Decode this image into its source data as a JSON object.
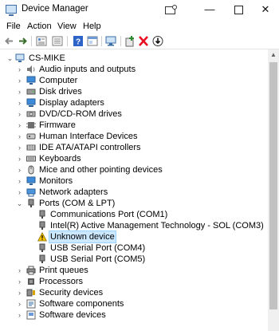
{
  "window": {
    "title": "Device Manager",
    "min_glyph": "—",
    "close_glyph": "✕"
  },
  "menu": [
    "File",
    "Action",
    "View",
    "Help"
  ],
  "toolbar": [
    "back-icon",
    "forward-icon",
    "properties-icon",
    "show-hidden-icon",
    "help-icon",
    "action-view-icon",
    "scan-hardware-icon",
    "add-driver-icon",
    "uninstall-icon",
    "update-driver-icon"
  ],
  "tree": {
    "root": "CS-MIKE",
    "categories": [
      "Audio inputs and outputs",
      "Computer",
      "Disk drives",
      "Display adapters",
      "DVD/CD-ROM drives",
      "Firmware",
      "Human Interface Devices",
      "IDE ATA/ATAPI controllers",
      "Keyboards",
      "Mice and other pointing devices",
      "Monitors",
      "Network adapters",
      "Ports (COM & LPT)"
    ],
    "ports": [
      "Communications Port (COM1)",
      "Intel(R) Active Management Technology - SOL (COM3)",
      "Unknown device",
      "USB Serial Port (COM4)",
      "USB Serial Port (COM5)"
    ],
    "after": [
      "Print queues",
      "Processors",
      "Security devices",
      "Software components",
      "Software devices"
    ],
    "selected": "Unknown device"
  },
  "colors": {
    "selection": "#cce8ff",
    "warning": "#f5c400",
    "uninstall": "#e81123",
    "add_driver": "#2e8b2e"
  }
}
